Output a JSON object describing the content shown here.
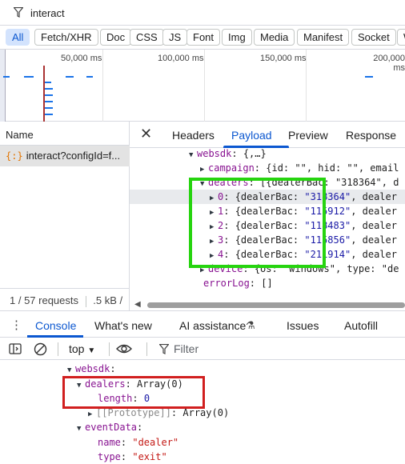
{
  "filter": {
    "value": "interact"
  },
  "type_filters": [
    "All",
    "Fetch/XHR",
    "Doc",
    "CSS",
    "JS",
    "Font",
    "Img",
    "Media",
    "Manifest",
    "Socket",
    "W"
  ],
  "overview": {
    "ticks": [
      "50,000 ms",
      "100,000 ms",
      "150,000 ms",
      "200,000 ms"
    ]
  },
  "request_list": {
    "header": "Name",
    "row": {
      "icon": "{:}",
      "name": "interact?configId=f..."
    },
    "status": {
      "count": "1 / 57 requests",
      "size": ".5 kB /"
    }
  },
  "detail_tabs": {
    "close": "✕",
    "tabs": [
      "Headers",
      "Payload",
      "Preview",
      "Response"
    ],
    "active": "Payload"
  },
  "payload": {
    "websdk": {
      "key": "websdk",
      "value": "{,…}"
    },
    "campaign": {
      "key": "campaign",
      "value": "{id: \"\", hid: \"\", email"
    },
    "dealers": {
      "key": "dealers",
      "value": "[{dealerBac: \"318364\", d"
    },
    "dealer_items": [
      {
        "index": "0",
        "prefix": "{dealerBac: ",
        "bac": "\"318364\"",
        "suffix": ", dealer"
      },
      {
        "index": "1",
        "prefix": "{dealerBac: ",
        "bac": "\"115912\"",
        "suffix": ", dealer"
      },
      {
        "index": "2",
        "prefix": "{dealerBac: ",
        "bac": "\"118483\"",
        "suffix": ", dealer"
      },
      {
        "index": "3",
        "prefix": "{dealerBac: ",
        "bac": "\"115856\"",
        "suffix": ", dealer"
      },
      {
        "index": "4",
        "prefix": "{dealerBac: ",
        "bac": "\"211914\"",
        "suffix": ", dealer"
      }
    ],
    "device": {
      "key": "device",
      "value": "{os: \"windows\", type: \"de"
    },
    "errorLog": {
      "key": "errorLog",
      "value": "[]"
    }
  },
  "drawer_tabs": [
    "Console",
    "What's new",
    "AI assistance",
    "Issues",
    "Autofill"
  ],
  "console_toolbar": {
    "context": "top",
    "filter_placeholder": "Filter"
  },
  "console": {
    "websdk": "websdk",
    "dealers_key": "dealers",
    "dealers_val": "Array(0)",
    "length_key": "length",
    "length_val": "0",
    "proto_key": "[[Prototype]]",
    "proto_val": "Array(0)",
    "eventData": "eventData",
    "name_key": "name",
    "name_val": "\"dealer\"",
    "type_key": "type",
    "type_val": "\"exit\""
  }
}
